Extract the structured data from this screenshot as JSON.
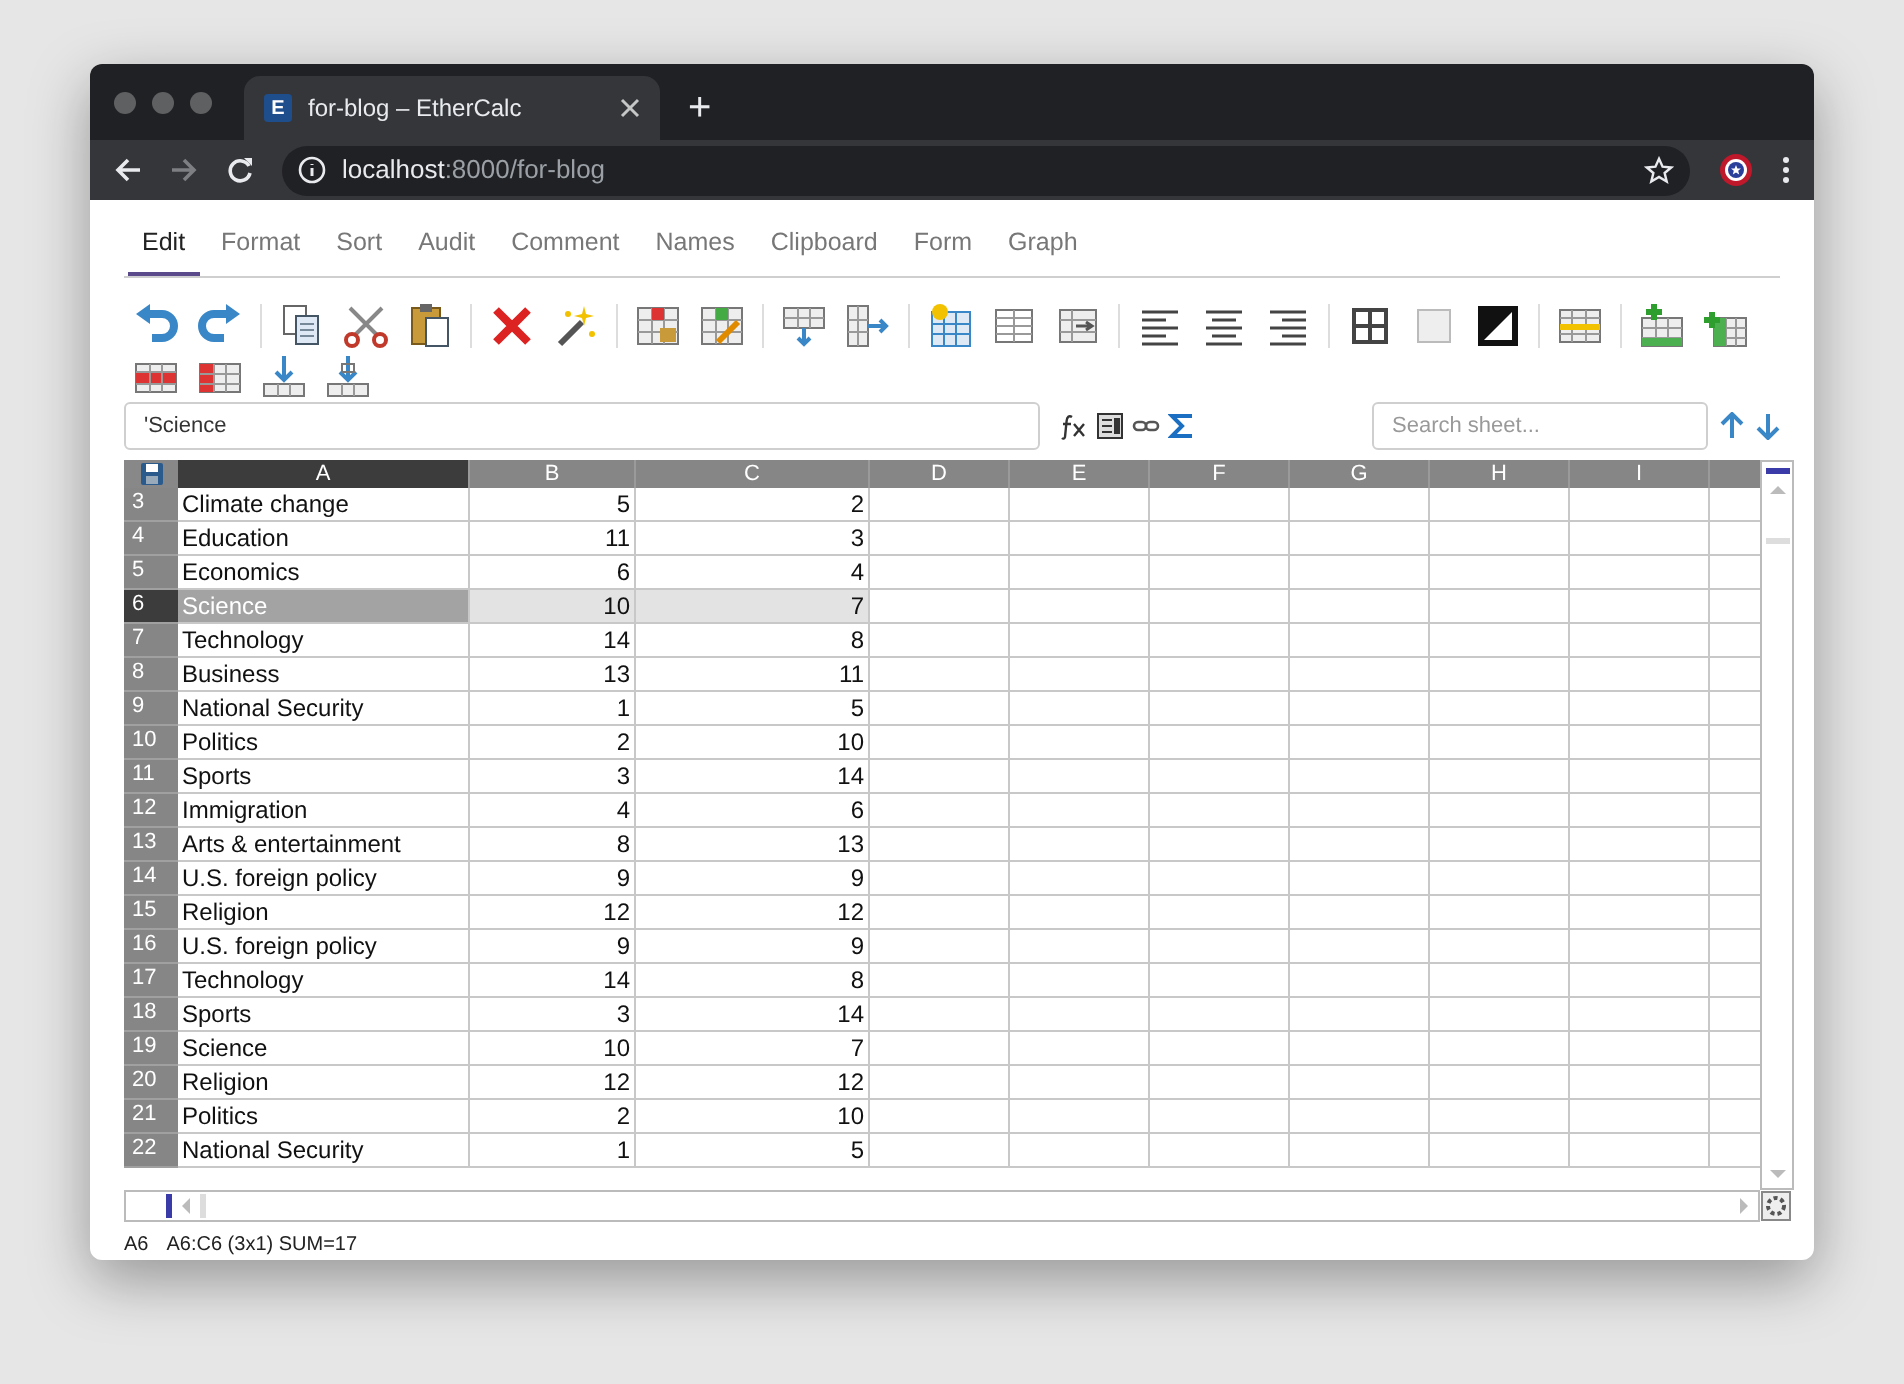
{
  "browser": {
    "logo_letter": "E",
    "tab_title": "for-blog – EtherCalc",
    "new_tab": "+",
    "url_host": "localhost",
    "url_rest": ":8000/for-blog"
  },
  "menu_tabs": [
    {
      "label": "Edit",
      "selected": true
    },
    {
      "label": "Format",
      "selected": false
    },
    {
      "label": "Sort",
      "selected": false
    },
    {
      "label": "Audit",
      "selected": false
    },
    {
      "label": "Comment",
      "selected": false
    },
    {
      "label": "Names",
      "selected": false
    },
    {
      "label": "Clipboard",
      "selected": false
    },
    {
      "label": "Form",
      "selected": false
    },
    {
      "label": "Graph",
      "selected": false
    }
  ],
  "formula_bar": {
    "value": "'Science"
  },
  "search": {
    "placeholder": "Search sheet..."
  },
  "columns": [
    {
      "label": "A",
      "selected": true
    },
    {
      "label": "B",
      "selected": false
    },
    {
      "label": "C",
      "selected": false
    },
    {
      "label": "D",
      "selected": false
    },
    {
      "label": "E",
      "selected": false
    },
    {
      "label": "F",
      "selected": false
    },
    {
      "label": "G",
      "selected": false
    },
    {
      "label": "H",
      "selected": false
    },
    {
      "label": "I",
      "selected": false
    }
  ],
  "rows": [
    {
      "number": "3",
      "cells": [
        "Climate change",
        "5",
        "2"
      ],
      "selected": false
    },
    {
      "number": "4",
      "cells": [
        "Education",
        "11",
        "3"
      ],
      "selected": false
    },
    {
      "number": "5",
      "cells": [
        "Economics",
        "6",
        "4"
      ],
      "selected": false
    },
    {
      "number": "6",
      "cells": [
        "Science",
        "10",
        "7"
      ],
      "selected": true
    },
    {
      "number": "7",
      "cells": [
        "Technology",
        "14",
        "8"
      ],
      "selected": false
    },
    {
      "number": "8",
      "cells": [
        "Business",
        "13",
        "11"
      ],
      "selected": false
    },
    {
      "number": "9",
      "cells": [
        "National Security",
        "1",
        "5"
      ],
      "selected": false
    },
    {
      "number": "10",
      "cells": [
        "Politics",
        "2",
        "10"
      ],
      "selected": false
    },
    {
      "number": "11",
      "cells": [
        "Sports",
        "3",
        "14"
      ],
      "selected": false
    },
    {
      "number": "12",
      "cells": [
        "Immigration",
        "4",
        "6"
      ],
      "selected": false
    },
    {
      "number": "13",
      "cells": [
        "Arts & entertainment",
        "8",
        "13"
      ],
      "selected": false
    },
    {
      "number": "14",
      "cells": [
        "U.S. foreign policy",
        "9",
        "9"
      ],
      "selected": false
    },
    {
      "number": "15",
      "cells": [
        "Religion",
        "12",
        "12"
      ],
      "selected": false
    },
    {
      "number": "16",
      "cells": [
        "U.S. foreign policy",
        "9",
        "9"
      ],
      "selected": false
    },
    {
      "number": "17",
      "cells": [
        "Technology",
        "14",
        "8"
      ],
      "selected": false
    },
    {
      "number": "18",
      "cells": [
        "Sports",
        "3",
        "14"
      ],
      "selected": false
    },
    {
      "number": "19",
      "cells": [
        "Science",
        "10",
        "7"
      ],
      "selected": false
    },
    {
      "number": "20",
      "cells": [
        "Religion",
        "12",
        "12"
      ],
      "selected": false
    },
    {
      "number": "21",
      "cells": [
        "Politics",
        "2",
        "10"
      ],
      "selected": false
    },
    {
      "number": "22",
      "cells": [
        "National Security",
        "1",
        "5"
      ],
      "selected": false
    }
  ],
  "status_bar": {
    "cell": "A6",
    "selection": "A6:C6 (3x1) SUM=17"
  }
}
